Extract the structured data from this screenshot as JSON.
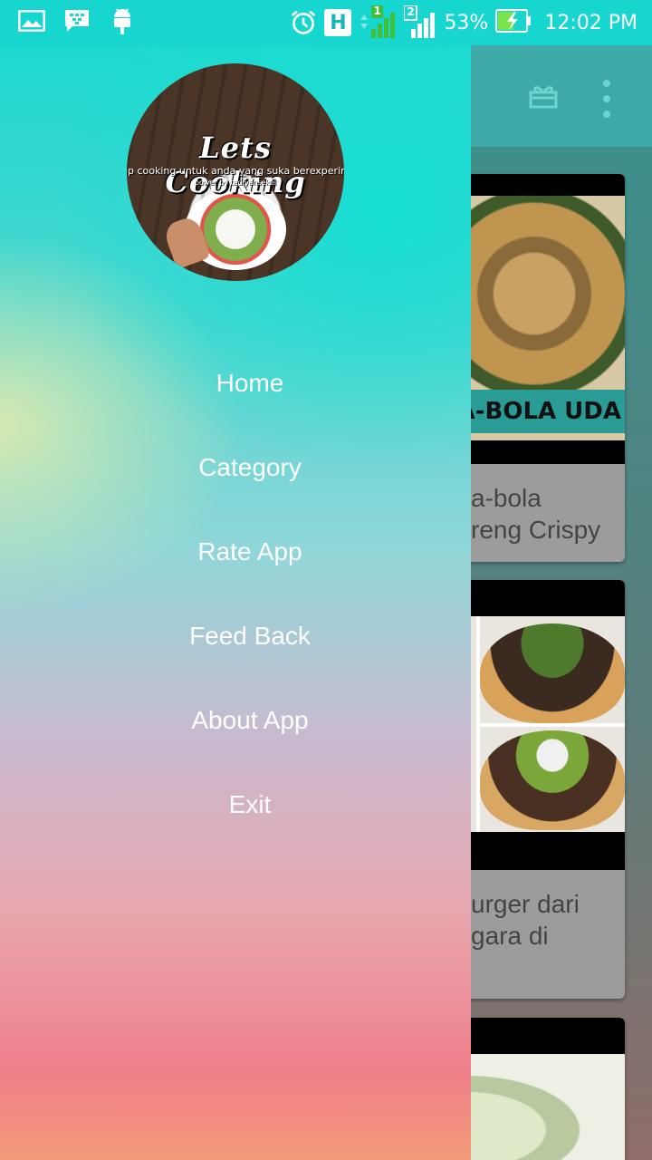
{
  "status_bar": {
    "icons_left": [
      "photo-icon",
      "bbm-icon",
      "android-icon"
    ],
    "icons_right": [
      "alarm-icon",
      "network-h-icon",
      "signal-sim1-icon",
      "signal-sim2-icon",
      "battery-charging-icon"
    ],
    "network_type": "H",
    "sim1_label": "1",
    "sim2_label": "2",
    "battery": "53%",
    "time": "12:02 PM"
  },
  "app_bar": {
    "icons": [
      "gift-icon",
      "more-vert-icon"
    ]
  },
  "content_cards": [
    {
      "image_banner": "A-BOLA UDA",
      "title_line1": "a-bola",
      "title_line2": "reng Crispy"
    },
    {
      "title_line1": "urger dari",
      "title_line2": "gara di"
    }
  ],
  "drawer": {
    "logo": {
      "title": "Lets Cooking",
      "subtitle": "pp cooking untuk anda yang suka berexperim",
      "power": "power by tadiyansekel"
    },
    "menu": [
      {
        "label": "Home"
      },
      {
        "label": "Category"
      },
      {
        "label": "Rate App"
      },
      {
        "label": "Feed Back"
      },
      {
        "label": "About App"
      },
      {
        "label": "Exit"
      }
    ]
  },
  "colors": {
    "status_bar": "#17d6d0",
    "app_bar": "#3ea9a6",
    "drawer_top": "#1dd9cf",
    "drawer_bottom": "#f07f8a"
  }
}
